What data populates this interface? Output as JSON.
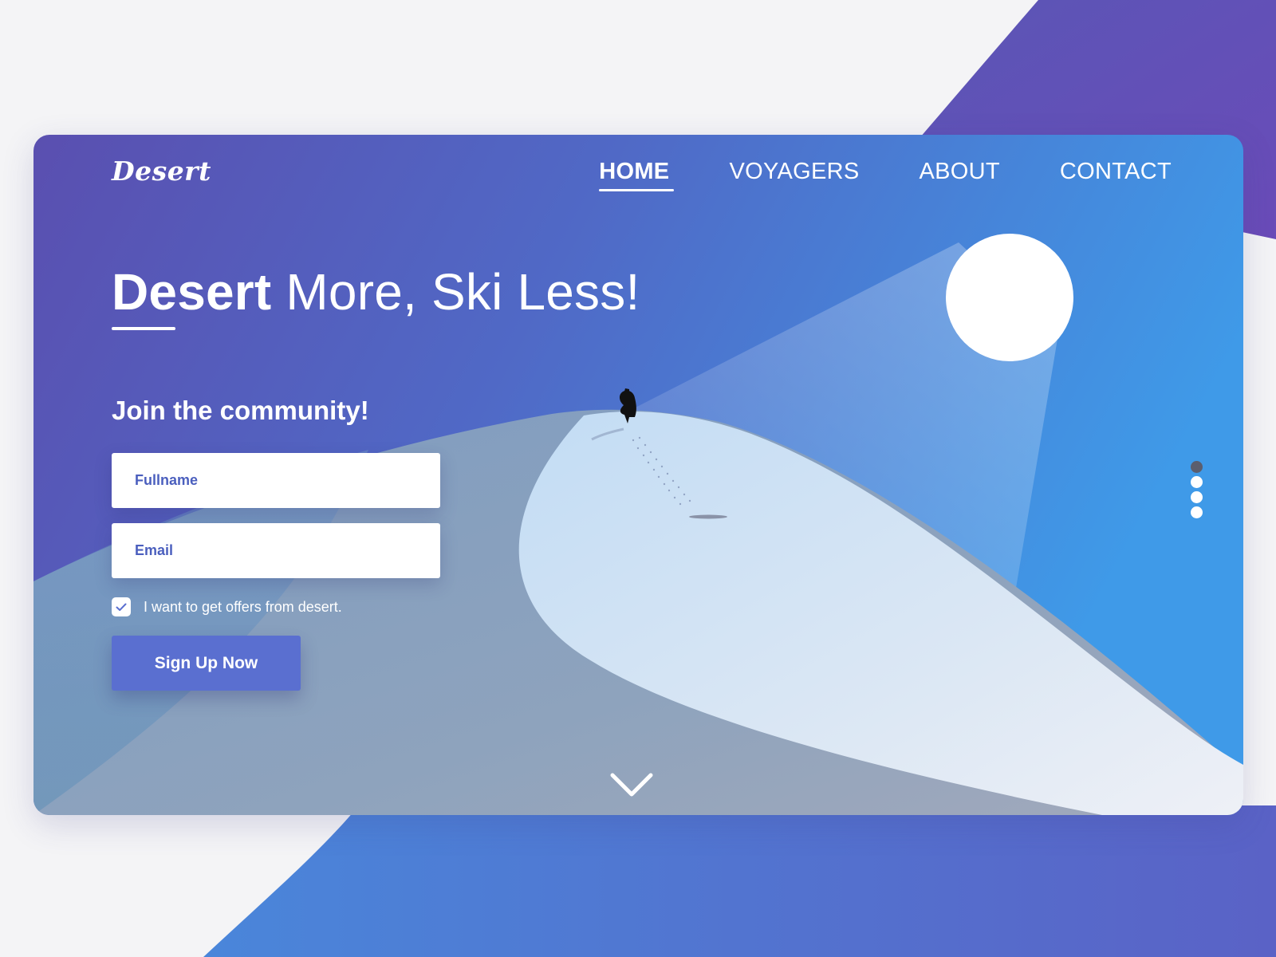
{
  "brand": {
    "logo": "Desert"
  },
  "nav": {
    "items": [
      {
        "label": "HOME",
        "active": true
      },
      {
        "label": "VOYAGERS",
        "active": false
      },
      {
        "label": "ABOUT",
        "active": false
      },
      {
        "label": "CONTACT",
        "active": false
      }
    ]
  },
  "hero": {
    "headline_bold": "Desert",
    "headline_rest": " More, Ski Less!"
  },
  "form": {
    "title": "Join the community!",
    "fullname_placeholder": "Fullname",
    "email_placeholder": "Email",
    "offers_label": "I want to get offers from desert.",
    "offers_checked": true,
    "submit_label": "Sign Up Now"
  },
  "pagination": {
    "count": 4,
    "active_index": 0
  },
  "icons": {
    "scroll": "chevron-down-icon",
    "check": "check-icon",
    "sun": "sun-circle",
    "traveler": "traveler-silhouette"
  },
  "colors": {
    "page_bg": "#f4f4f6",
    "purple": "#6a4bb8",
    "blue": "#3f9ae8",
    "accent": "#5a6fd0",
    "input_text": "#4b5fbe"
  }
}
